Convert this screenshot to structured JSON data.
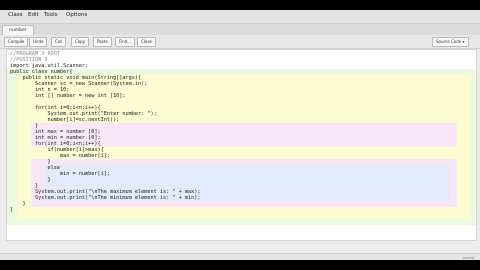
{
  "menu": [
    "Class",
    "Edit",
    "Tools",
    "Options"
  ],
  "tab": {
    "label": "number"
  },
  "toolbar": {
    "buttons": [
      "Compile",
      "Undo",
      "Cut",
      "Copy",
      "Paste",
      "Find...",
      "Close"
    ],
    "view_mode": "Source Code"
  },
  "code": {
    "lines": [
      "//PROGRAM 3 ROOT",
      "//POSITION 3",
      "import java.util.Scanner;",
      "public class number{",
      "    public static void main(String[]args){",
      "        Scanner sc = new Scanner(System.in);",
      "        int n = 10;",
      "        int [] number = new int [10];",
      "",
      "        for(int i=0;i<n;i++){",
      "            System.out.print(\"Enter number: \");",
      "            number[i]=sc.nextInt();",
      "        }",
      "        int max = number [0];",
      "        int min = number [0];",
      "        for(int i=0;i<n;i++){",
      "            if(number[i]>max){",
      "                max = number[i];",
      "            }",
      "            else",
      "                min = number[i];",
      "            }",
      "        }",
      "        System.out.print(\"\\nThe maximum element is: \" + max);",
      "        System.out.print(\"\\nThe minimum element is: \" + min);",
      "    }",
      "}"
    ]
  },
  "status": {
    "text": "saved"
  },
  "colors": {
    "class_scope": "#edf8e0",
    "method_scope": "#fdfbd2",
    "loop_scope": "#f8e7f6",
    "if_scope": "#e3ebfa",
    "comment": "#8a8a8a",
    "keyword": "#7a1f1f",
    "string": "#2a2aa5"
  }
}
